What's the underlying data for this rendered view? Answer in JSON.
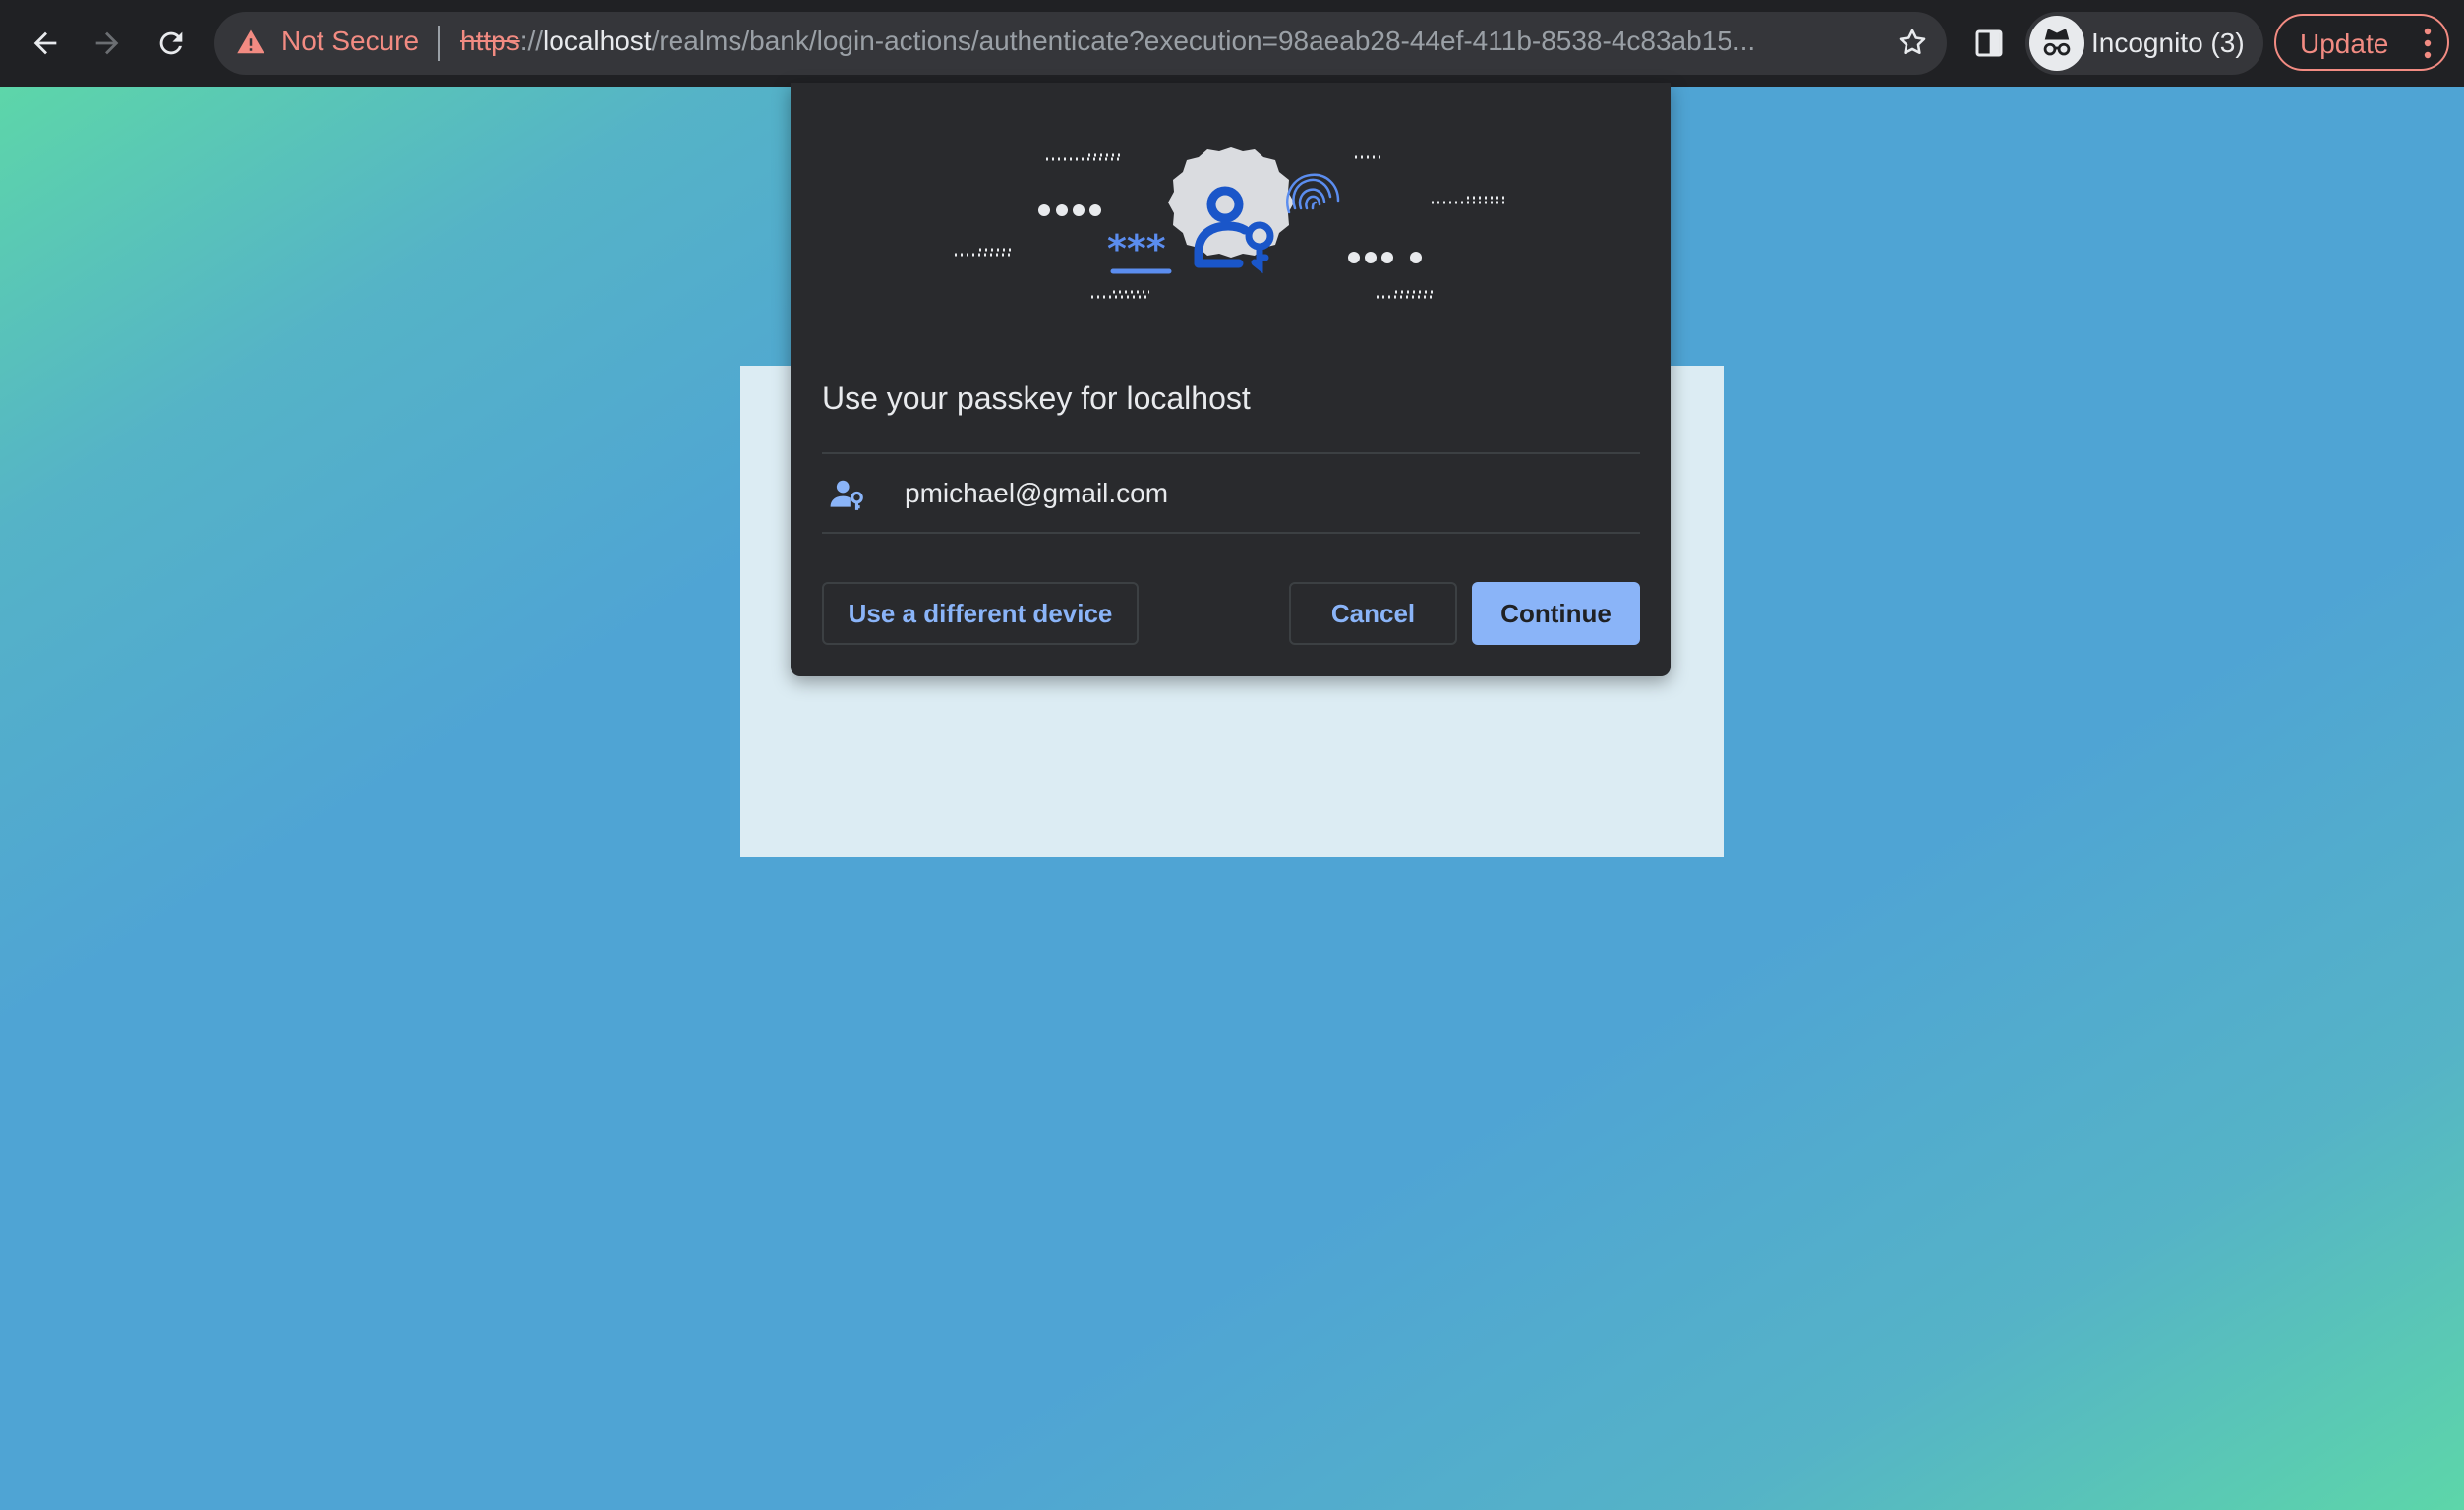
{
  "browser": {
    "security_label": "Not Secure",
    "url_scheme": "https",
    "url_sep": "://",
    "url_host": "localhost",
    "url_path": "/realms/bank/login-actions/authenticate?execution=98aeab28-44ef-411b-8538-4c83ab15...",
    "profile_label": "Incognito (3)",
    "update_label": "Update",
    "icons": {
      "back": "back-arrow-icon",
      "forward": "forward-arrow-icon",
      "reload": "reload-icon",
      "warning": "warning-icon",
      "bookmark": "star-icon",
      "side_panel": "side-panel-icon",
      "incognito": "incognito-icon",
      "menu": "kebab-menu-icon"
    }
  },
  "dialog": {
    "title": "Use your passkey for localhost",
    "account_email": "pmichael@gmail.com",
    "secondary_button": "Use a different device",
    "cancel_button": "Cancel",
    "continue_button": "Continue",
    "illustration_icon": "passkey-icon",
    "account_icon": "person-key-icon"
  },
  "colors": {
    "toolbar_bg": "#202124",
    "omnibox_bg": "#35363a",
    "warning": "#f28b82",
    "dialog_bg": "#292a2d",
    "accent_blue": "#8ab4f8",
    "passkey_blue": "#1a56c9",
    "page_gradient_green": "#5dd6a9",
    "page_gradient_blue": "#4fa4d4",
    "login_card": "#dcecf3"
  }
}
